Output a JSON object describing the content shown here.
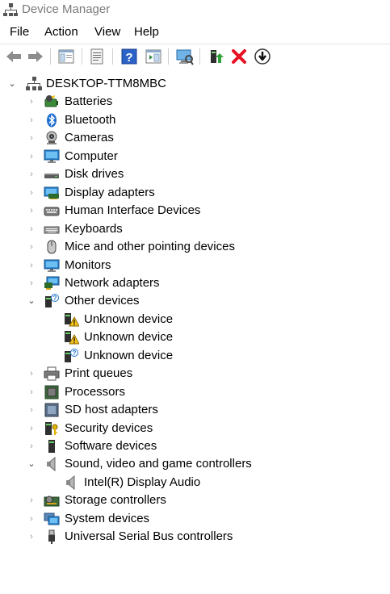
{
  "window": {
    "title": "Device Manager"
  },
  "menu": [
    "File",
    "Action",
    "View",
    "Help"
  ],
  "toolbar": [
    "back-icon",
    "forward-icon",
    "show-hide-console-tree-icon",
    "properties-icon",
    "help-icon",
    "action-pane-icon",
    "scan-for-hardware-changes-icon",
    "update-driver-icon",
    "uninstall-device-icon",
    "disable-device-icon"
  ],
  "tree": {
    "root": "DESKTOP-TTM8MBC",
    "categories": [
      {
        "label": "Batteries",
        "icon": "battery-icon",
        "expanded": false
      },
      {
        "label": "Bluetooth",
        "icon": "bluetooth-icon",
        "expanded": false
      },
      {
        "label": "Cameras",
        "icon": "camera-icon",
        "expanded": false
      },
      {
        "label": "Computer",
        "icon": "computer-icon",
        "expanded": false
      },
      {
        "label": "Disk drives",
        "icon": "disk-drive-icon",
        "expanded": false
      },
      {
        "label": "Display adapters",
        "icon": "display-adapter-icon",
        "expanded": false
      },
      {
        "label": "Human Interface Devices",
        "icon": "hid-icon",
        "expanded": false
      },
      {
        "label": "Keyboards",
        "icon": "keyboard-icon",
        "expanded": false
      },
      {
        "label": "Mice and other pointing devices",
        "icon": "mouse-icon",
        "expanded": false
      },
      {
        "label": "Monitors",
        "icon": "monitor-icon",
        "expanded": false
      },
      {
        "label": "Network adapters",
        "icon": "network-adapter-icon",
        "expanded": false
      },
      {
        "label": "Other devices",
        "icon": "other-devices-icon",
        "expanded": true,
        "children": [
          {
            "label": "Unknown device",
            "icon": "unknown-device-warning-icon"
          },
          {
            "label": "Unknown device",
            "icon": "unknown-device-warning-icon"
          },
          {
            "label": "Unknown device",
            "icon": "unknown-device-icon"
          }
        ]
      },
      {
        "label": "Print queues",
        "icon": "printer-icon",
        "expanded": false
      },
      {
        "label": "Processors",
        "icon": "processor-icon",
        "expanded": false
      },
      {
        "label": "SD host adapters",
        "icon": "sd-host-icon",
        "expanded": false
      },
      {
        "label": "Security devices",
        "icon": "security-device-icon",
        "expanded": false
      },
      {
        "label": "Software devices",
        "icon": "software-device-icon",
        "expanded": false
      },
      {
        "label": "Sound, video and game controllers",
        "icon": "speaker-icon",
        "expanded": true,
        "children": [
          {
            "label": "Intel(R) Display Audio",
            "icon": "speaker-icon"
          }
        ]
      },
      {
        "label": "Storage controllers",
        "icon": "storage-controller-icon",
        "expanded": false
      },
      {
        "label": "System devices",
        "icon": "system-devices-icon",
        "expanded": false
      },
      {
        "label": "Universal Serial Bus controllers",
        "icon": "usb-icon",
        "expanded": false
      }
    ]
  },
  "colors": {
    "title_text": "#7a7a7a",
    "uninstall_red": "#e81123",
    "accent_blue": "#2a7ad4"
  }
}
